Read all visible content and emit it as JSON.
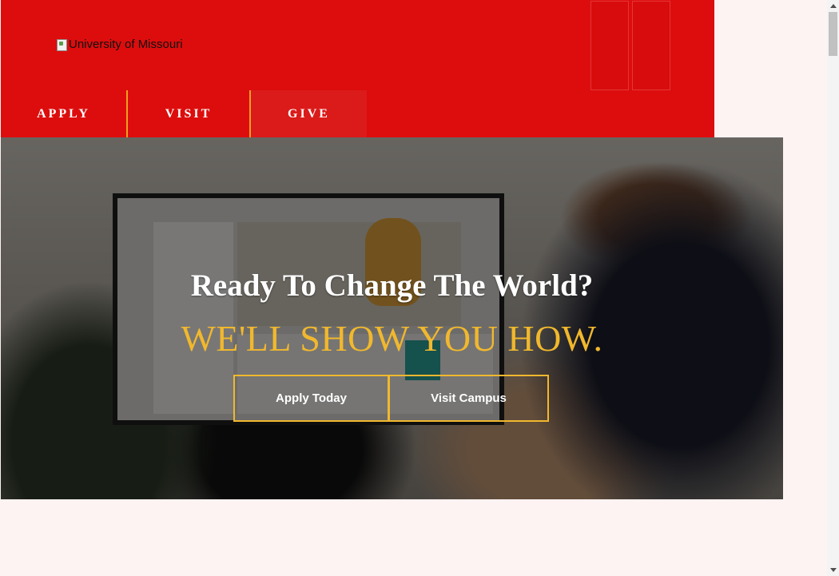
{
  "header": {
    "logo_alt": "University of Missouri",
    "brand_color": "#dd0d0d",
    "buttons": [
      {
        "name": "header-action-1",
        "icon": "search-icon"
      },
      {
        "name": "header-action-2",
        "icon": "menu-icon"
      }
    ]
  },
  "nav": {
    "items": [
      {
        "label": "APPLY"
      },
      {
        "label": "VISIT"
      },
      {
        "label": "GIVE"
      }
    ],
    "separator_color": "#f0a020"
  },
  "hero": {
    "headline": "Ready To Change The World?",
    "subhead": "WE'LL SHOW YOU HOW.",
    "accent_color": "#f1b82d",
    "cta": {
      "apply_label": "Apply Today",
      "visit_label": "Visit Campus"
    }
  }
}
